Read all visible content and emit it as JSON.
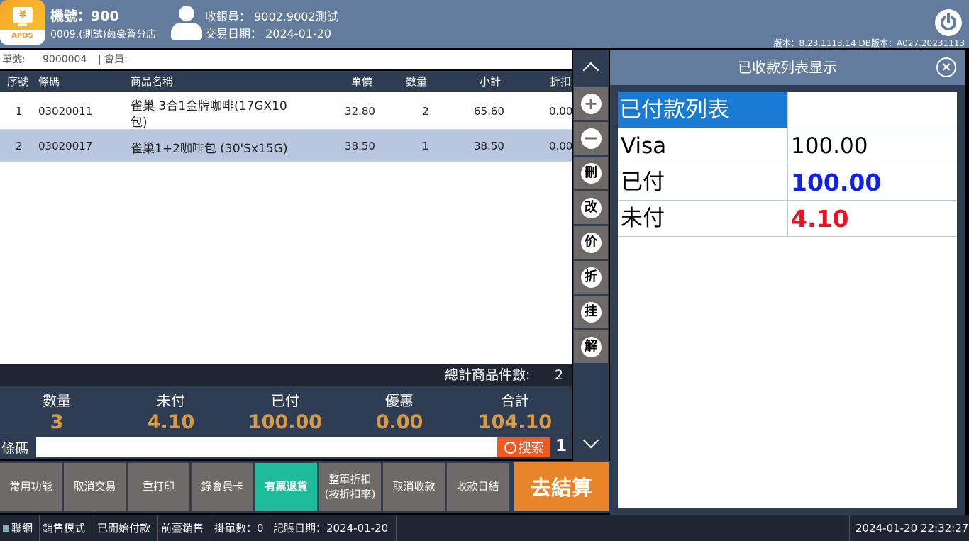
{
  "header": {
    "logo_text": "APOS",
    "logo_symbol": "¥",
    "machine": "機號：900",
    "store": "0009.(測試)茵豪薈分店",
    "cashier": "收銀員：  9002.9002測試",
    "trade_date": "交易日期：  2024-01-20",
    "version": "版本：8.23.1113.14 DB版本：A027.20231113"
  },
  "order": {
    "label": "單號:",
    "number": "9000004",
    "member_label": "| 會員:"
  },
  "table": {
    "columns": [
      "序號",
      "條碼",
      "商品名稱",
      "單價",
      "數量",
      "小計",
      "折扣"
    ],
    "rows": [
      {
        "no": "1",
        "code": "03020011",
        "name": "雀巢 3合1金牌咖啡(17GX10",
        "name2": "包)",
        "price": "32.80",
        "qty": "2",
        "subtotal": "65.60",
        "discount": "0.00"
      },
      {
        "no": "2",
        "code": "03020017",
        "name": "雀巢1+2咖啡包 (30'Sx15G)",
        "name2": "",
        "price": "38.50",
        "qty": "1",
        "subtotal": "38.50",
        "discount": "0.00"
      }
    ]
  },
  "summary": {
    "count_label": "總計商品件數:",
    "count": "2"
  },
  "totals": [
    {
      "label": "數量",
      "value": "3"
    },
    {
      "label": "未付",
      "value": "4.10"
    },
    {
      "label": "已付",
      "value": "100.00"
    },
    {
      "label": "優惠",
      "value": "0.00"
    },
    {
      "label": "合計",
      "value": "104.10"
    }
  ],
  "barcode": {
    "label": "條碼",
    "value": "",
    "search": "搜索",
    "qty": "1"
  },
  "side": [
    "+",
    "−",
    "刪",
    "改",
    "价",
    "折",
    "挂",
    "解"
  ],
  "functions": [
    "常用功能",
    "取消交易",
    "重打印",
    "錄會員卡",
    "有票退貨",
    "整單折扣(按折扣率)",
    "取消收款",
    "收款日結"
  ],
  "checkout": "去結算",
  "status": {
    "network": "聯網",
    "mode": "銷售模式",
    "pay": "已開始付款",
    "front": "前臺銷售",
    "hold": "掛單數：0",
    "acct_date": "記賬日期：2024-01-20",
    "datetime": "2024-01-20 22:32:27"
  },
  "payment_panel": {
    "title": "已收款列表显示",
    "list_title": "已付款列表",
    "rows": [
      {
        "label": "Visa",
        "value": "100.00"
      },
      {
        "label": "已付",
        "value": "100.00"
      },
      {
        "label": "未付",
        "value": "4.10"
      }
    ]
  },
  "colors": {
    "header": "#637b9c",
    "accent": "#1a7bd4",
    "checkout": "#e8842a",
    "return": "#1fbc9c",
    "paid": "#1020f0",
    "unpaid": "#f01020",
    "gold": "#d99a45"
  }
}
